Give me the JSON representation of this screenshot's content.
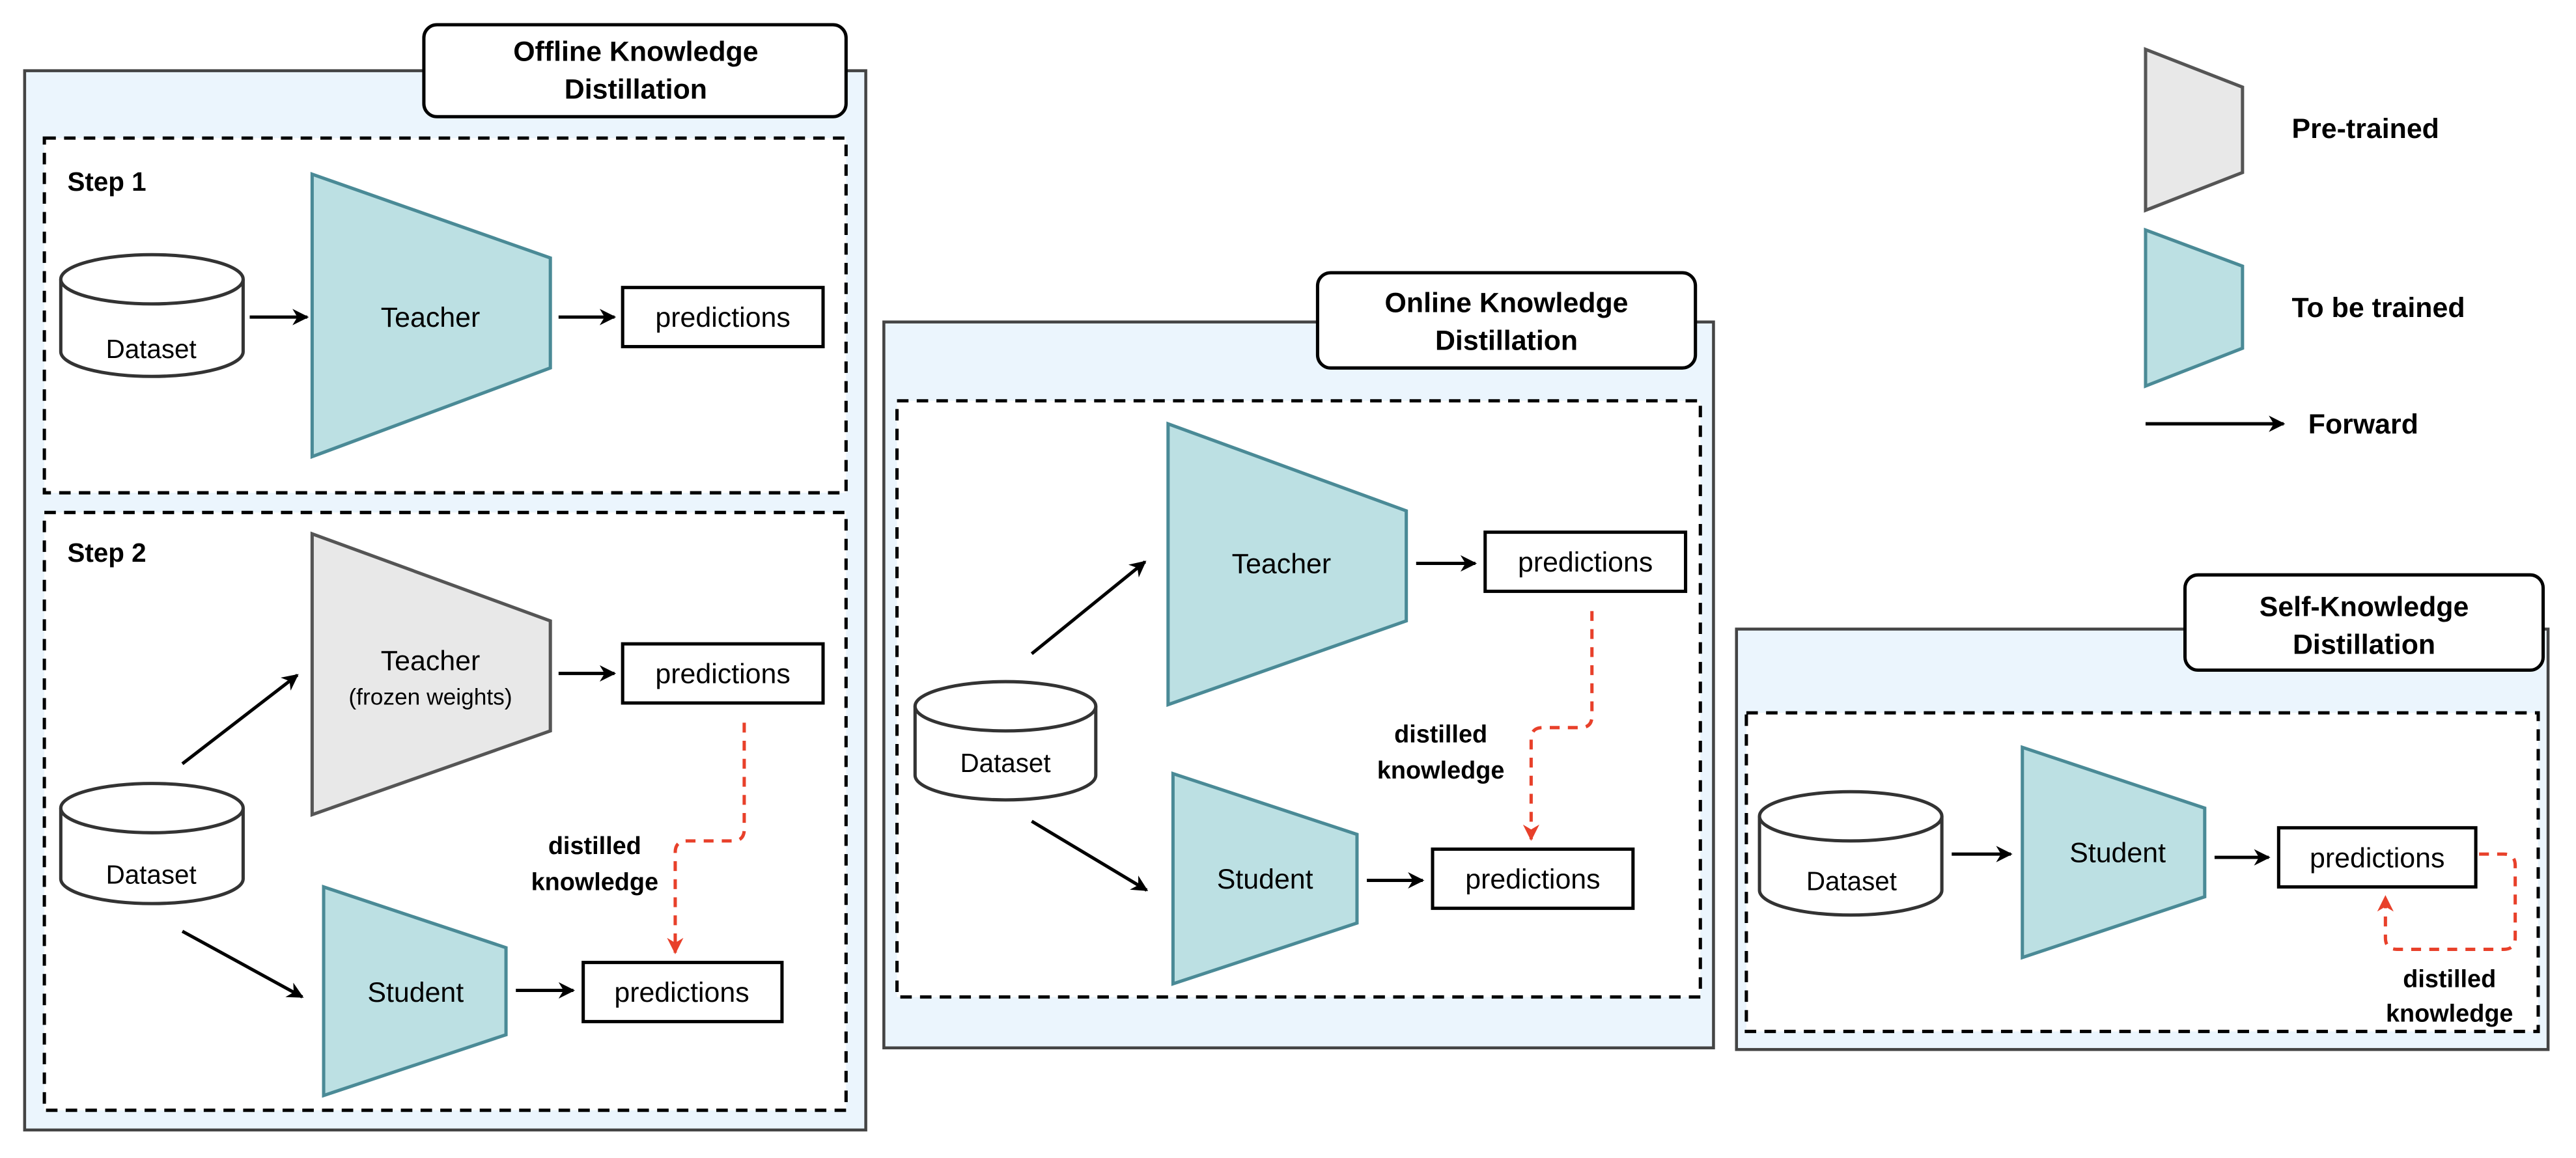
{
  "offline": {
    "title_line1": "Offline Knowledge",
    "title_line2": "Distillation",
    "step1": {
      "label": "Step 1",
      "dataset": "Dataset",
      "teacher": "Teacher",
      "predictions": "predictions"
    },
    "step2": {
      "label": "Step 2",
      "dataset": "Dataset",
      "teacher": "Teacher",
      "teacher_note": "(frozen weights)",
      "teacher_predictions": "predictions",
      "student": "Student",
      "student_predictions": "predictions",
      "distilled_line1": "distilled",
      "distilled_line2": "knowledge"
    }
  },
  "online": {
    "title_line1": "Online Knowledge",
    "title_line2": "Distillation",
    "dataset": "Dataset",
    "teacher": "Teacher",
    "teacher_predictions": "predictions",
    "student": "Student",
    "student_predictions": "predictions",
    "distilled_line1": "distilled",
    "distilled_line2": "knowledge"
  },
  "self": {
    "title_line1": "Self-Knowledge",
    "title_line2": "Distillation",
    "dataset": "Dataset",
    "student": "Student",
    "predictions": "predictions",
    "distilled_line1": "distilled",
    "distilled_line2": "knowledge"
  },
  "legend": {
    "pretrained": "Pre-trained",
    "to_be_trained": "To be trained",
    "forward": "Forward"
  },
  "colors": {
    "panel_bg": "#EBF5FD",
    "to_be_trained": "#BCE0E3",
    "pretrained": "#E8E8E8",
    "distilled_arrow": "#E8402A"
  }
}
